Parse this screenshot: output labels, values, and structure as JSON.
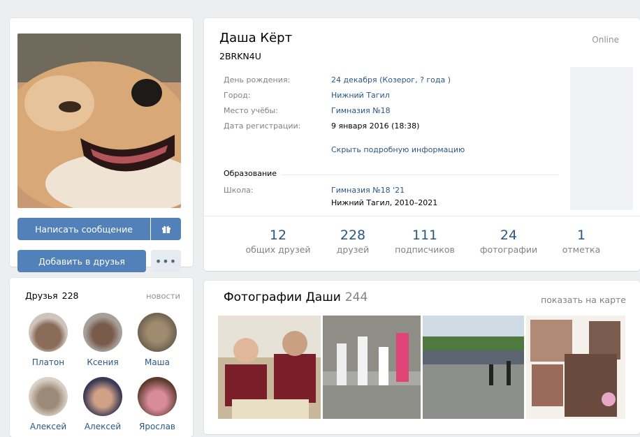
{
  "profile": {
    "name": "Даша Кёрт",
    "status": "2BRKN4U",
    "online": "Online",
    "message_button": "Написать сообщение",
    "add_friend_button": "Добавить в друзья",
    "more_button": "•••"
  },
  "info": {
    "birthday_label": "День рождения:",
    "birthday_value": "24 декабря (Козерог, ? года )",
    "city_label": "Город:",
    "city_value": "Нижний Тагил",
    "study_label": "Место учёбы:",
    "study_value": "Гимназия №18",
    "reg_label": "Дата регистрации:",
    "reg_value": "9 января 2016 (18:38)",
    "hide_link": "Скрыть подробную информацию",
    "education_title": "Образование",
    "school_label": "Школа:",
    "school_value_1": "Гимназия №18 '21",
    "school_value_2": "Нижний Тагил, 2010–2021"
  },
  "counters": [
    {
      "num": "12",
      "label": "общих друзей"
    },
    {
      "num": "228",
      "label": "друзей"
    },
    {
      "num": "111",
      "label": "подписчиков"
    },
    {
      "num": "24",
      "label": "фотографии"
    },
    {
      "num": "1",
      "label": "отметка"
    }
  ],
  "friends": {
    "title": "Друзья",
    "count": "228",
    "news_link": "новости",
    "items": [
      {
        "name": "Платон"
      },
      {
        "name": "Ксения"
      },
      {
        "name": "Маша"
      },
      {
        "name": "Алексей"
      },
      {
        "name": "Алексей"
      },
      {
        "name": "Ярослав"
      }
    ]
  },
  "photos": {
    "title": "Фотографии Даши",
    "count": "244",
    "map_link": "показать на карте"
  },
  "colors": {
    "accent": "#5181b8",
    "link": "#2a5885",
    "background": "#edeef0"
  }
}
